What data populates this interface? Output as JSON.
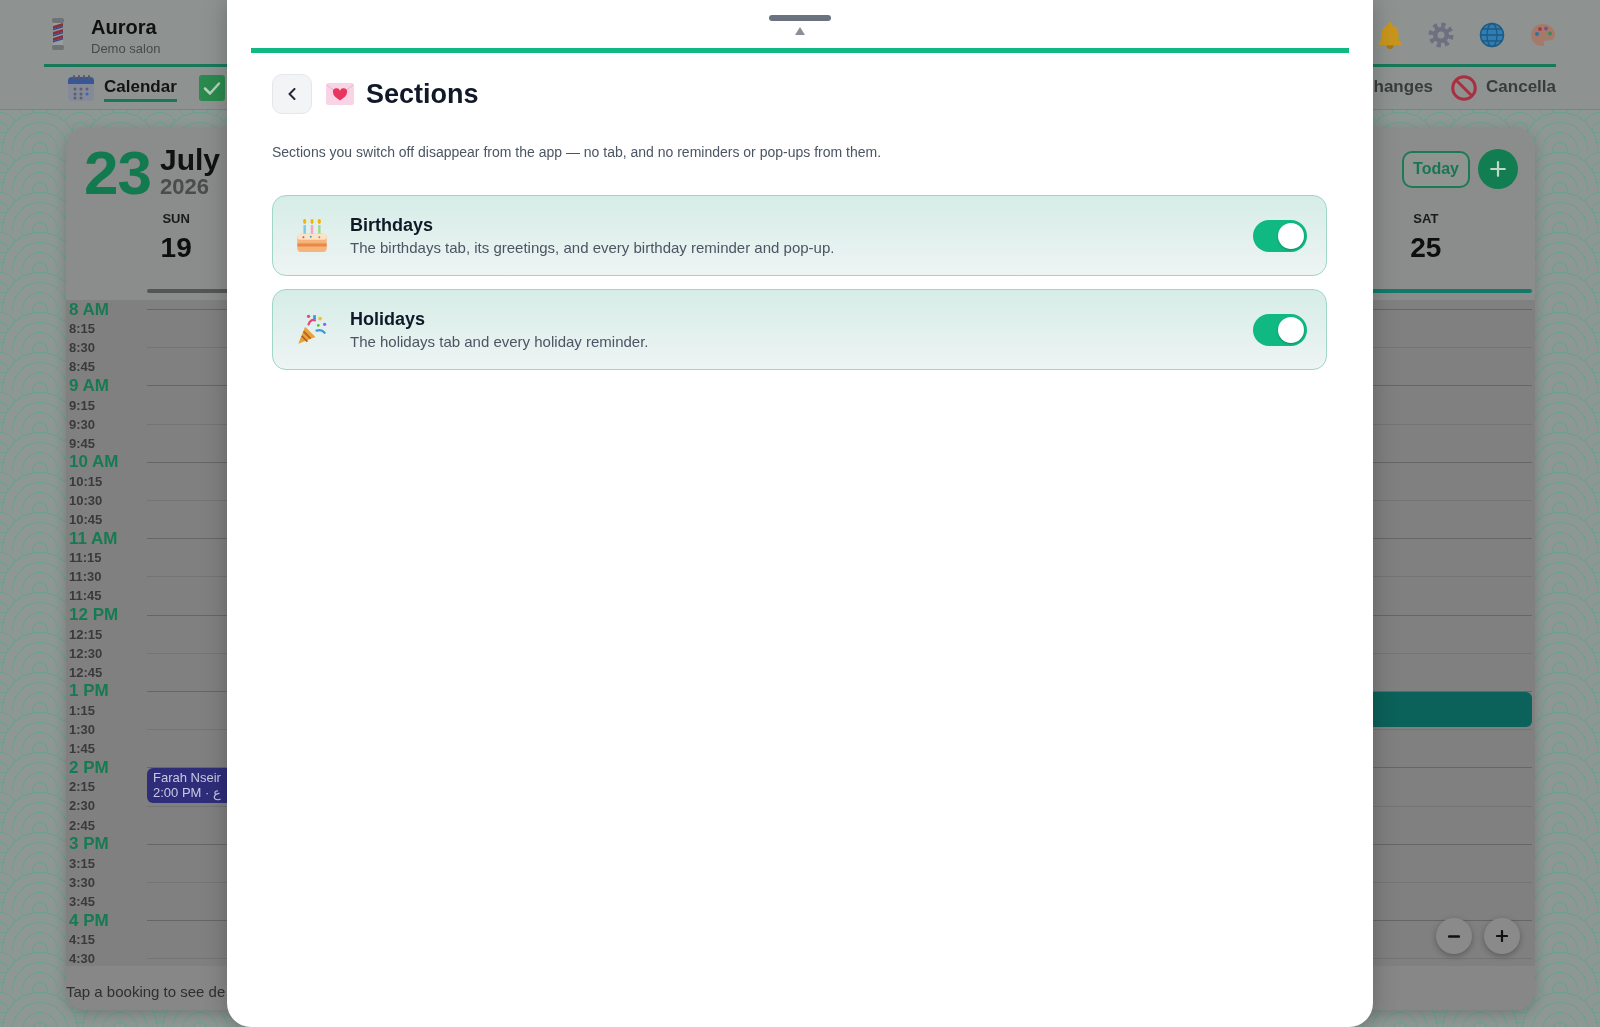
{
  "app": {
    "name": "Aurora",
    "subtitle": "Demo salon"
  },
  "nav_tabs": [
    {
      "kind": "calendar",
      "label": "Calendar",
      "selected": true
    },
    {
      "kind": "check",
      "selected": false
    },
    {
      "kind": "plain",
      "label": "hanges",
      "selected": false
    },
    {
      "kind": "prohibited",
      "label": "Cancella",
      "selected": false
    }
  ],
  "calendar": {
    "day": "23",
    "month": "July",
    "year": "2026",
    "today_button": "Today",
    "days": [
      {
        "weekday": "SUN",
        "date": "19"
      },
      {
        "weekday": "SAT",
        "date": "25"
      }
    ],
    "times": [
      {
        "kind": "hour",
        "label": "8 AM"
      },
      {
        "kind": "quarter",
        "label": "8:15"
      },
      {
        "kind": "quarter",
        "label": "8:30"
      },
      {
        "kind": "quarter",
        "label": "8:45"
      },
      {
        "kind": "hour",
        "label": "9 AM"
      },
      {
        "kind": "quarter",
        "label": "9:15"
      },
      {
        "kind": "quarter",
        "label": "9:30"
      },
      {
        "kind": "quarter",
        "label": "9:45"
      },
      {
        "kind": "hour",
        "label": "10 AM"
      },
      {
        "kind": "quarter",
        "label": "10:15"
      },
      {
        "kind": "quarter",
        "label": "10:30"
      },
      {
        "kind": "quarter",
        "label": "10:45"
      },
      {
        "kind": "hour",
        "label": "11 AM"
      },
      {
        "kind": "quarter",
        "label": "11:15"
      },
      {
        "kind": "quarter",
        "label": "11:30"
      },
      {
        "kind": "quarter",
        "label": "11:45"
      },
      {
        "kind": "hour",
        "label": "12 PM"
      },
      {
        "kind": "quarter",
        "label": "12:15"
      },
      {
        "kind": "quarter",
        "label": "12:30"
      },
      {
        "kind": "quarter",
        "label": "12:45"
      },
      {
        "kind": "hour",
        "label": "1 PM"
      },
      {
        "kind": "quarter",
        "label": "1:15"
      },
      {
        "kind": "quarter",
        "label": "1:30"
      },
      {
        "kind": "quarter",
        "label": "1:45"
      },
      {
        "kind": "hour",
        "label": "2 PM"
      },
      {
        "kind": "quarter",
        "label": "2:15"
      },
      {
        "kind": "quarter",
        "label": "2:30"
      },
      {
        "kind": "quarter",
        "label": "2:45"
      },
      {
        "kind": "hour",
        "label": "3 PM"
      },
      {
        "kind": "quarter",
        "label": "3:15"
      },
      {
        "kind": "quarter",
        "label": "3:30"
      },
      {
        "kind": "quarter",
        "label": "3:45"
      },
      {
        "kind": "hour",
        "label": "4 PM"
      },
      {
        "kind": "quarter",
        "label": "4:15"
      },
      {
        "kind": "quarter",
        "label": "4:30"
      }
    ],
    "events": [
      {
        "title": "Farah Nseir",
        "time": "2:00 PM · ع",
        "color": "#2e2d7a"
      },
      {
        "color": "#0b625a"
      }
    ],
    "hint": "Tap a booking to see de"
  },
  "sheet": {
    "title": "Sections",
    "description": "Sections you switch off disappear from the app — no tab, and no reminders or pop-ups from them.",
    "sections": [
      {
        "title": "Birthdays",
        "description": "The birthdays tab, its greetings, and every birthday reminder and pop-up.",
        "on": true
      },
      {
        "title": "Holidays",
        "description": "The holidays tab and every holiday reminder.",
        "on": true
      }
    ]
  }
}
